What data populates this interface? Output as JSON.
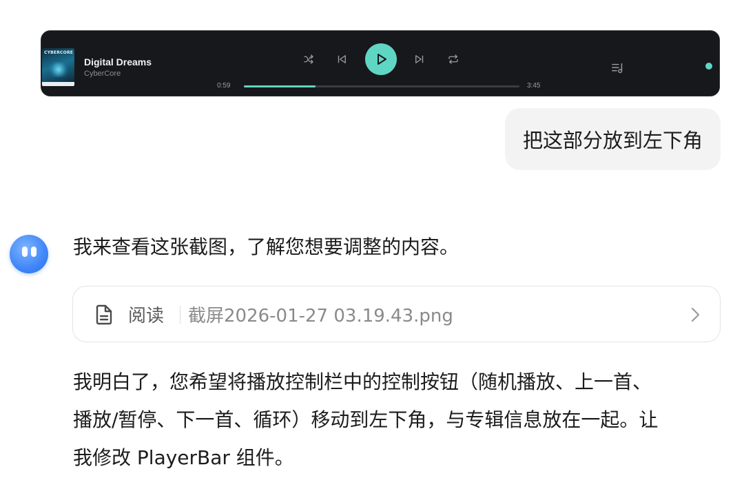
{
  "player": {
    "album_art_text": "CYBERCORE",
    "track_title": "Digital Dreams",
    "artist": "CyberCore",
    "current_time": "0:59",
    "total_time": "3:45",
    "progress": 0.26,
    "accent_color": "#5fd6c4",
    "icons": {
      "shuffle": "shuffle-icon",
      "previous": "skip-previous-icon",
      "play": "play-icon",
      "next": "skip-next-icon",
      "repeat": "repeat-icon",
      "queue": "queue-list-icon"
    }
  },
  "user_message": {
    "text": "把这部分放到左下角"
  },
  "assistant": {
    "avatar_icon": "assistant-avatar-icon",
    "message_1": "我来查看这张截图，了解您想要调整的内容。",
    "file_card": {
      "icon": "document-icon",
      "action_label": "阅读",
      "file_name": "截屏2026-01-27 03.19.43.png",
      "chevron_icon": "chevron-right-icon"
    },
    "message_2_line_1": "我明白了，您希望将播放控制栏中的控制按钮（随机播放、上一首、",
    "message_2_line_2": "播放/暂停、下一首、循环）移动到左下角，与专辑信息放在一起。让",
    "message_2_line_3": "我修改 PlayerBar 组件。"
  }
}
